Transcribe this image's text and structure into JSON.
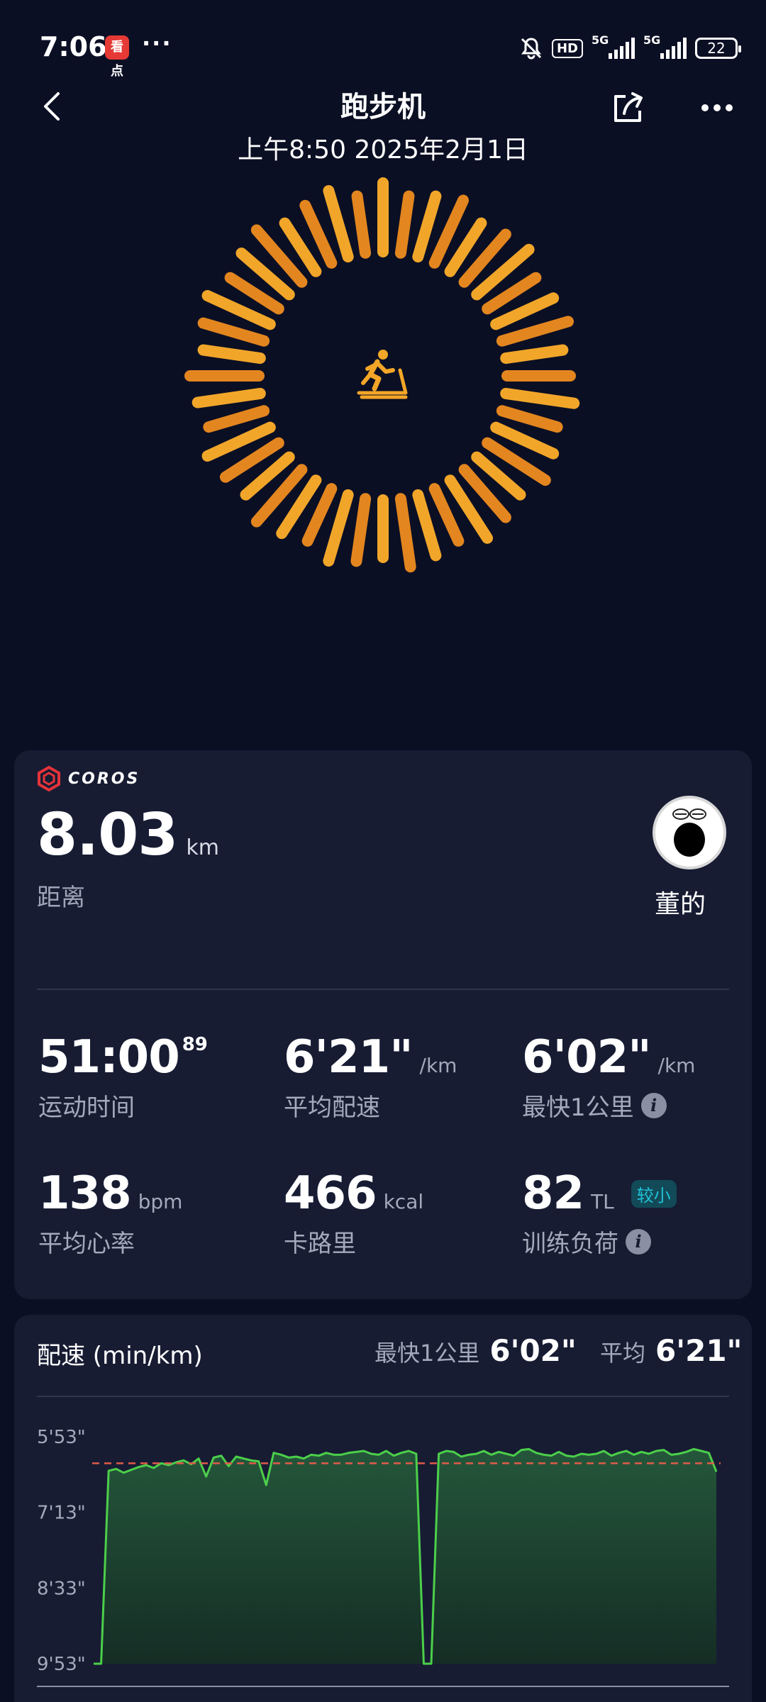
{
  "status_bar": {
    "time": "7:06",
    "app_badge": "看点",
    "dots": "···",
    "hd": "HD",
    "net1": "5G",
    "net2": "5G",
    "battery": "22"
  },
  "header": {
    "title": "跑步机",
    "datetime": "上午8:50 2025年2月1日"
  },
  "icons": {
    "back": "chevron-left-icon",
    "share": "share-icon",
    "more": "more-horizontal-icon",
    "activity": "treadmill-runner-icon"
  },
  "colors": {
    "background": "#0b0f24",
    "card": "#171c33",
    "accent_orange": "#f0a12a",
    "accent_deep": "#cf5c12",
    "pace_line": "#4ccf4a",
    "pace_fill": "#1f4a2f",
    "avg_line": "#e05a4a"
  },
  "summary": {
    "brand": "COROS",
    "distance_value": "8.03",
    "distance_unit": "km",
    "distance_label": "距离",
    "user_name": "董的",
    "metrics": [
      {
        "value": "51:00",
        "sup": "89",
        "unit": "",
        "label": "运动时间"
      },
      {
        "value": "6'21\"",
        "unit": "/km",
        "label": "平均配速"
      },
      {
        "value": "6'02\"",
        "unit": "/km",
        "label": "最快1公里",
        "info": true
      },
      {
        "value": "138",
        "unit": "bpm",
        "label": "平均心率"
      },
      {
        "value": "466",
        "unit": "kcal",
        "label": "卡路里"
      },
      {
        "value": "82",
        "unit": "TL",
        "badge": "较小",
        "label": "训练负荷",
        "info": true
      }
    ]
  },
  "pace": {
    "title": "配速 (min/km)",
    "fastest_label": "最快1公里",
    "fastest_value": "6'02\"",
    "avg_label": "平均",
    "avg_value": "6'21\""
  },
  "chart_data": {
    "type": "area",
    "title": "配速 (min/km)",
    "y_ticks": [
      "5'53\"",
      "7'13\"",
      "8'33\"",
      "9'53\""
    ],
    "ylim_seconds": [
      353,
      593
    ],
    "y_inverted": true,
    "avg_line_seconds": 381,
    "series": [
      {
        "values_seconds": [
          593,
          593,
          389,
          387,
          391,
          388,
          385,
          383,
          386,
          381,
          383,
          380,
          378,
          382,
          376,
          395,
          375,
          373,
          384,
          374,
          376,
          378,
          379,
          404,
          370,
          372,
          375,
          374,
          376,
          372,
          373,
          370,
          372,
          372,
          370,
          369,
          368,
          371,
          372,
          368,
          373,
          370,
          368,
          371,
          593,
          593,
          371,
          368,
          369,
          374,
          372,
          371,
          368,
          372,
          369,
          371,
          373,
          367,
          366,
          370,
          372,
          373,
          369,
          373,
          374,
          371,
          372,
          371,
          368,
          373,
          370,
          368,
          372,
          369,
          371,
          368,
          367,
          372,
          371,
          369,
          366,
          368,
          370,
          390
        ]
      }
    ]
  }
}
